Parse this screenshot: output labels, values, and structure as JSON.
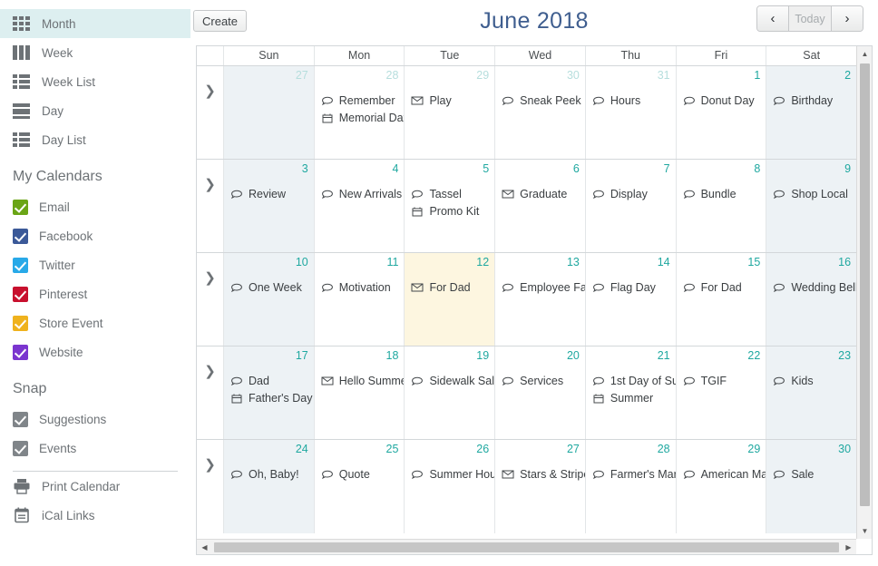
{
  "sidebar": {
    "views": [
      {
        "label": "Month",
        "icon": "grid-month-icon",
        "active": true
      },
      {
        "label": "Week",
        "icon": "columns-week-icon",
        "active": false
      },
      {
        "label": "Week List",
        "icon": "list-week-icon",
        "active": false
      },
      {
        "label": "Day",
        "icon": "rows-day-icon",
        "active": false
      },
      {
        "label": "Day List",
        "icon": "list-day-icon",
        "active": false
      }
    ],
    "my_calendars_title": "My Calendars",
    "calendars": [
      {
        "label": "Email",
        "color": "#6aa516",
        "checked": true
      },
      {
        "label": "Facebook",
        "color": "#3b5998",
        "checked": true
      },
      {
        "label": "Twitter",
        "color": "#28a9e8",
        "checked": true
      },
      {
        "label": "Pinterest",
        "color": "#c8102e",
        "checked": true
      },
      {
        "label": "Store Event",
        "color": "#efb21d",
        "checked": true
      },
      {
        "label": "Website",
        "color": "#7b35cf",
        "checked": true
      }
    ],
    "snap_title": "Snap",
    "snap": [
      {
        "label": "Suggestions",
        "color": "#808589",
        "checked": true
      },
      {
        "label": "Events",
        "color": "#808589",
        "checked": true
      }
    ],
    "tools": [
      {
        "label": "Print Calendar",
        "icon": "printer-icon"
      },
      {
        "label": "iCal Links",
        "icon": "calendar-links-icon"
      }
    ]
  },
  "toolbar": {
    "create_label": "Create",
    "title": "June 2018",
    "prev_label": "‹",
    "today_label": "Today",
    "next_label": "›",
    "prev_icon": "chevron-left-icon",
    "next_icon": "chevron-right-icon"
  },
  "calendar": {
    "day_headers": [
      "Sun",
      "Mon",
      "Tue",
      "Wed",
      "Thu",
      "Fri",
      "Sat"
    ],
    "expand_icon": "chevron-right-icon",
    "weeks": [
      {
        "days": [
          {
            "num": "27",
            "other_month": true,
            "weekend": true,
            "today": false,
            "events": []
          },
          {
            "num": "28",
            "other_month": true,
            "weekend": false,
            "today": false,
            "events": [
              {
                "title": "Remember",
                "icon": "social-post-icon"
              },
              {
                "title": "Memorial Day",
                "icon": "holiday-icon"
              }
            ]
          },
          {
            "num": "29",
            "other_month": true,
            "weekend": false,
            "today": false,
            "events": [
              {
                "title": "Play",
                "icon": "email-icon"
              }
            ]
          },
          {
            "num": "30",
            "other_month": true,
            "weekend": false,
            "today": false,
            "events": [
              {
                "title": "Sneak Peek",
                "icon": "social-post-icon"
              }
            ]
          },
          {
            "num": "31",
            "other_month": true,
            "weekend": false,
            "today": false,
            "events": [
              {
                "title": "Hours",
                "icon": "social-post-icon"
              }
            ]
          },
          {
            "num": "1",
            "other_month": false,
            "weekend": false,
            "today": false,
            "events": [
              {
                "title": "Donut Day",
                "icon": "social-post-icon"
              }
            ]
          },
          {
            "num": "2",
            "other_month": false,
            "weekend": true,
            "today": false,
            "events": [
              {
                "title": "Birthday",
                "icon": "social-post-icon"
              }
            ]
          }
        ]
      },
      {
        "days": [
          {
            "num": "3",
            "other_month": false,
            "weekend": true,
            "today": false,
            "events": [
              {
                "title": "Review",
                "icon": "social-post-icon"
              }
            ]
          },
          {
            "num": "4",
            "other_month": false,
            "weekend": false,
            "today": false,
            "events": [
              {
                "title": "New Arrivals",
                "icon": "social-post-icon"
              }
            ]
          },
          {
            "num": "5",
            "other_month": false,
            "weekend": false,
            "today": false,
            "events": [
              {
                "title": "Tassel",
                "icon": "social-post-icon"
              },
              {
                "title": "Promo Kit",
                "icon": "holiday-icon"
              }
            ]
          },
          {
            "num": "6",
            "other_month": false,
            "weekend": false,
            "today": false,
            "events": [
              {
                "title": "Graduate",
                "icon": "email-icon"
              }
            ]
          },
          {
            "num": "7",
            "other_month": false,
            "weekend": false,
            "today": false,
            "events": [
              {
                "title": "Display",
                "icon": "social-post-icon"
              }
            ]
          },
          {
            "num": "8",
            "other_month": false,
            "weekend": false,
            "today": false,
            "events": [
              {
                "title": "Bundle",
                "icon": "social-post-icon"
              }
            ]
          },
          {
            "num": "9",
            "other_month": false,
            "weekend": true,
            "today": false,
            "events": [
              {
                "title": "Shop Local",
                "icon": "social-post-icon"
              }
            ]
          }
        ]
      },
      {
        "days": [
          {
            "num": "10",
            "other_month": false,
            "weekend": true,
            "today": false,
            "events": [
              {
                "title": "One Week",
                "icon": "social-post-icon"
              }
            ]
          },
          {
            "num": "11",
            "other_month": false,
            "weekend": false,
            "today": false,
            "events": [
              {
                "title": "Motivation",
                "icon": "social-post-icon"
              }
            ]
          },
          {
            "num": "12",
            "other_month": false,
            "weekend": false,
            "today": true,
            "events": [
              {
                "title": "For Dad",
                "icon": "email-icon"
              }
            ]
          },
          {
            "num": "13",
            "other_month": false,
            "weekend": false,
            "today": false,
            "events": [
              {
                "title": "Employee Fa",
                "icon": "social-post-icon"
              }
            ]
          },
          {
            "num": "14",
            "other_month": false,
            "weekend": false,
            "today": false,
            "events": [
              {
                "title": "Flag Day",
                "icon": "social-post-icon"
              }
            ]
          },
          {
            "num": "15",
            "other_month": false,
            "weekend": false,
            "today": false,
            "events": [
              {
                "title": "For Dad",
                "icon": "social-post-icon"
              }
            ]
          },
          {
            "num": "16",
            "other_month": false,
            "weekend": true,
            "today": false,
            "events": [
              {
                "title": "Wedding Bell",
                "icon": "social-post-icon"
              }
            ]
          }
        ]
      },
      {
        "days": [
          {
            "num": "17",
            "other_month": false,
            "weekend": true,
            "today": false,
            "events": [
              {
                "title": "Dad",
                "icon": "social-post-icon"
              },
              {
                "title": "Father's Day",
                "icon": "holiday-icon"
              }
            ]
          },
          {
            "num": "18",
            "other_month": false,
            "weekend": false,
            "today": false,
            "events": [
              {
                "title": "Hello Summe",
                "icon": "email-icon"
              }
            ]
          },
          {
            "num": "19",
            "other_month": false,
            "weekend": false,
            "today": false,
            "events": [
              {
                "title": "Sidewalk Sal",
                "icon": "social-post-icon"
              }
            ]
          },
          {
            "num": "20",
            "other_month": false,
            "weekend": false,
            "today": false,
            "events": [
              {
                "title": "Services",
                "icon": "social-post-icon"
              }
            ]
          },
          {
            "num": "21",
            "other_month": false,
            "weekend": false,
            "today": false,
            "events": [
              {
                "title": "1st Day of Su",
                "icon": "social-post-icon"
              },
              {
                "title": "Summer",
                "icon": "holiday-icon"
              }
            ]
          },
          {
            "num": "22",
            "other_month": false,
            "weekend": false,
            "today": false,
            "events": [
              {
                "title": "TGIF",
                "icon": "social-post-icon"
              }
            ]
          },
          {
            "num": "23",
            "other_month": false,
            "weekend": true,
            "today": false,
            "events": [
              {
                "title": "Kids",
                "icon": "social-post-icon"
              }
            ]
          }
        ]
      },
      {
        "days": [
          {
            "num": "24",
            "other_month": false,
            "weekend": true,
            "today": false,
            "events": [
              {
                "title": "Oh, Baby!",
                "icon": "social-post-icon"
              }
            ]
          },
          {
            "num": "25",
            "other_month": false,
            "weekend": false,
            "today": false,
            "events": [
              {
                "title": "Quote",
                "icon": "social-post-icon"
              }
            ]
          },
          {
            "num": "26",
            "other_month": false,
            "weekend": false,
            "today": false,
            "events": [
              {
                "title": "Summer Hou",
                "icon": "social-post-icon"
              }
            ]
          },
          {
            "num": "27",
            "other_month": false,
            "weekend": false,
            "today": false,
            "events": [
              {
                "title": "Stars & Stripe",
                "icon": "email-icon"
              }
            ]
          },
          {
            "num": "28",
            "other_month": false,
            "weekend": false,
            "today": false,
            "events": [
              {
                "title": "Farmer's Mar",
                "icon": "social-post-icon"
              }
            ]
          },
          {
            "num": "29",
            "other_month": false,
            "weekend": false,
            "today": false,
            "events": [
              {
                "title": "American Ma",
                "icon": "social-post-icon"
              }
            ]
          },
          {
            "num": "30",
            "other_month": false,
            "weekend": true,
            "today": false,
            "events": [
              {
                "title": "Sale",
                "icon": "social-post-icon"
              }
            ]
          }
        ]
      }
    ]
  },
  "scrollbars": {
    "up_icon": "triangle-up-icon",
    "down_icon": "triangle-down-icon",
    "left_icon": "triangle-left-icon",
    "right_icon": "triangle-right-icon"
  }
}
